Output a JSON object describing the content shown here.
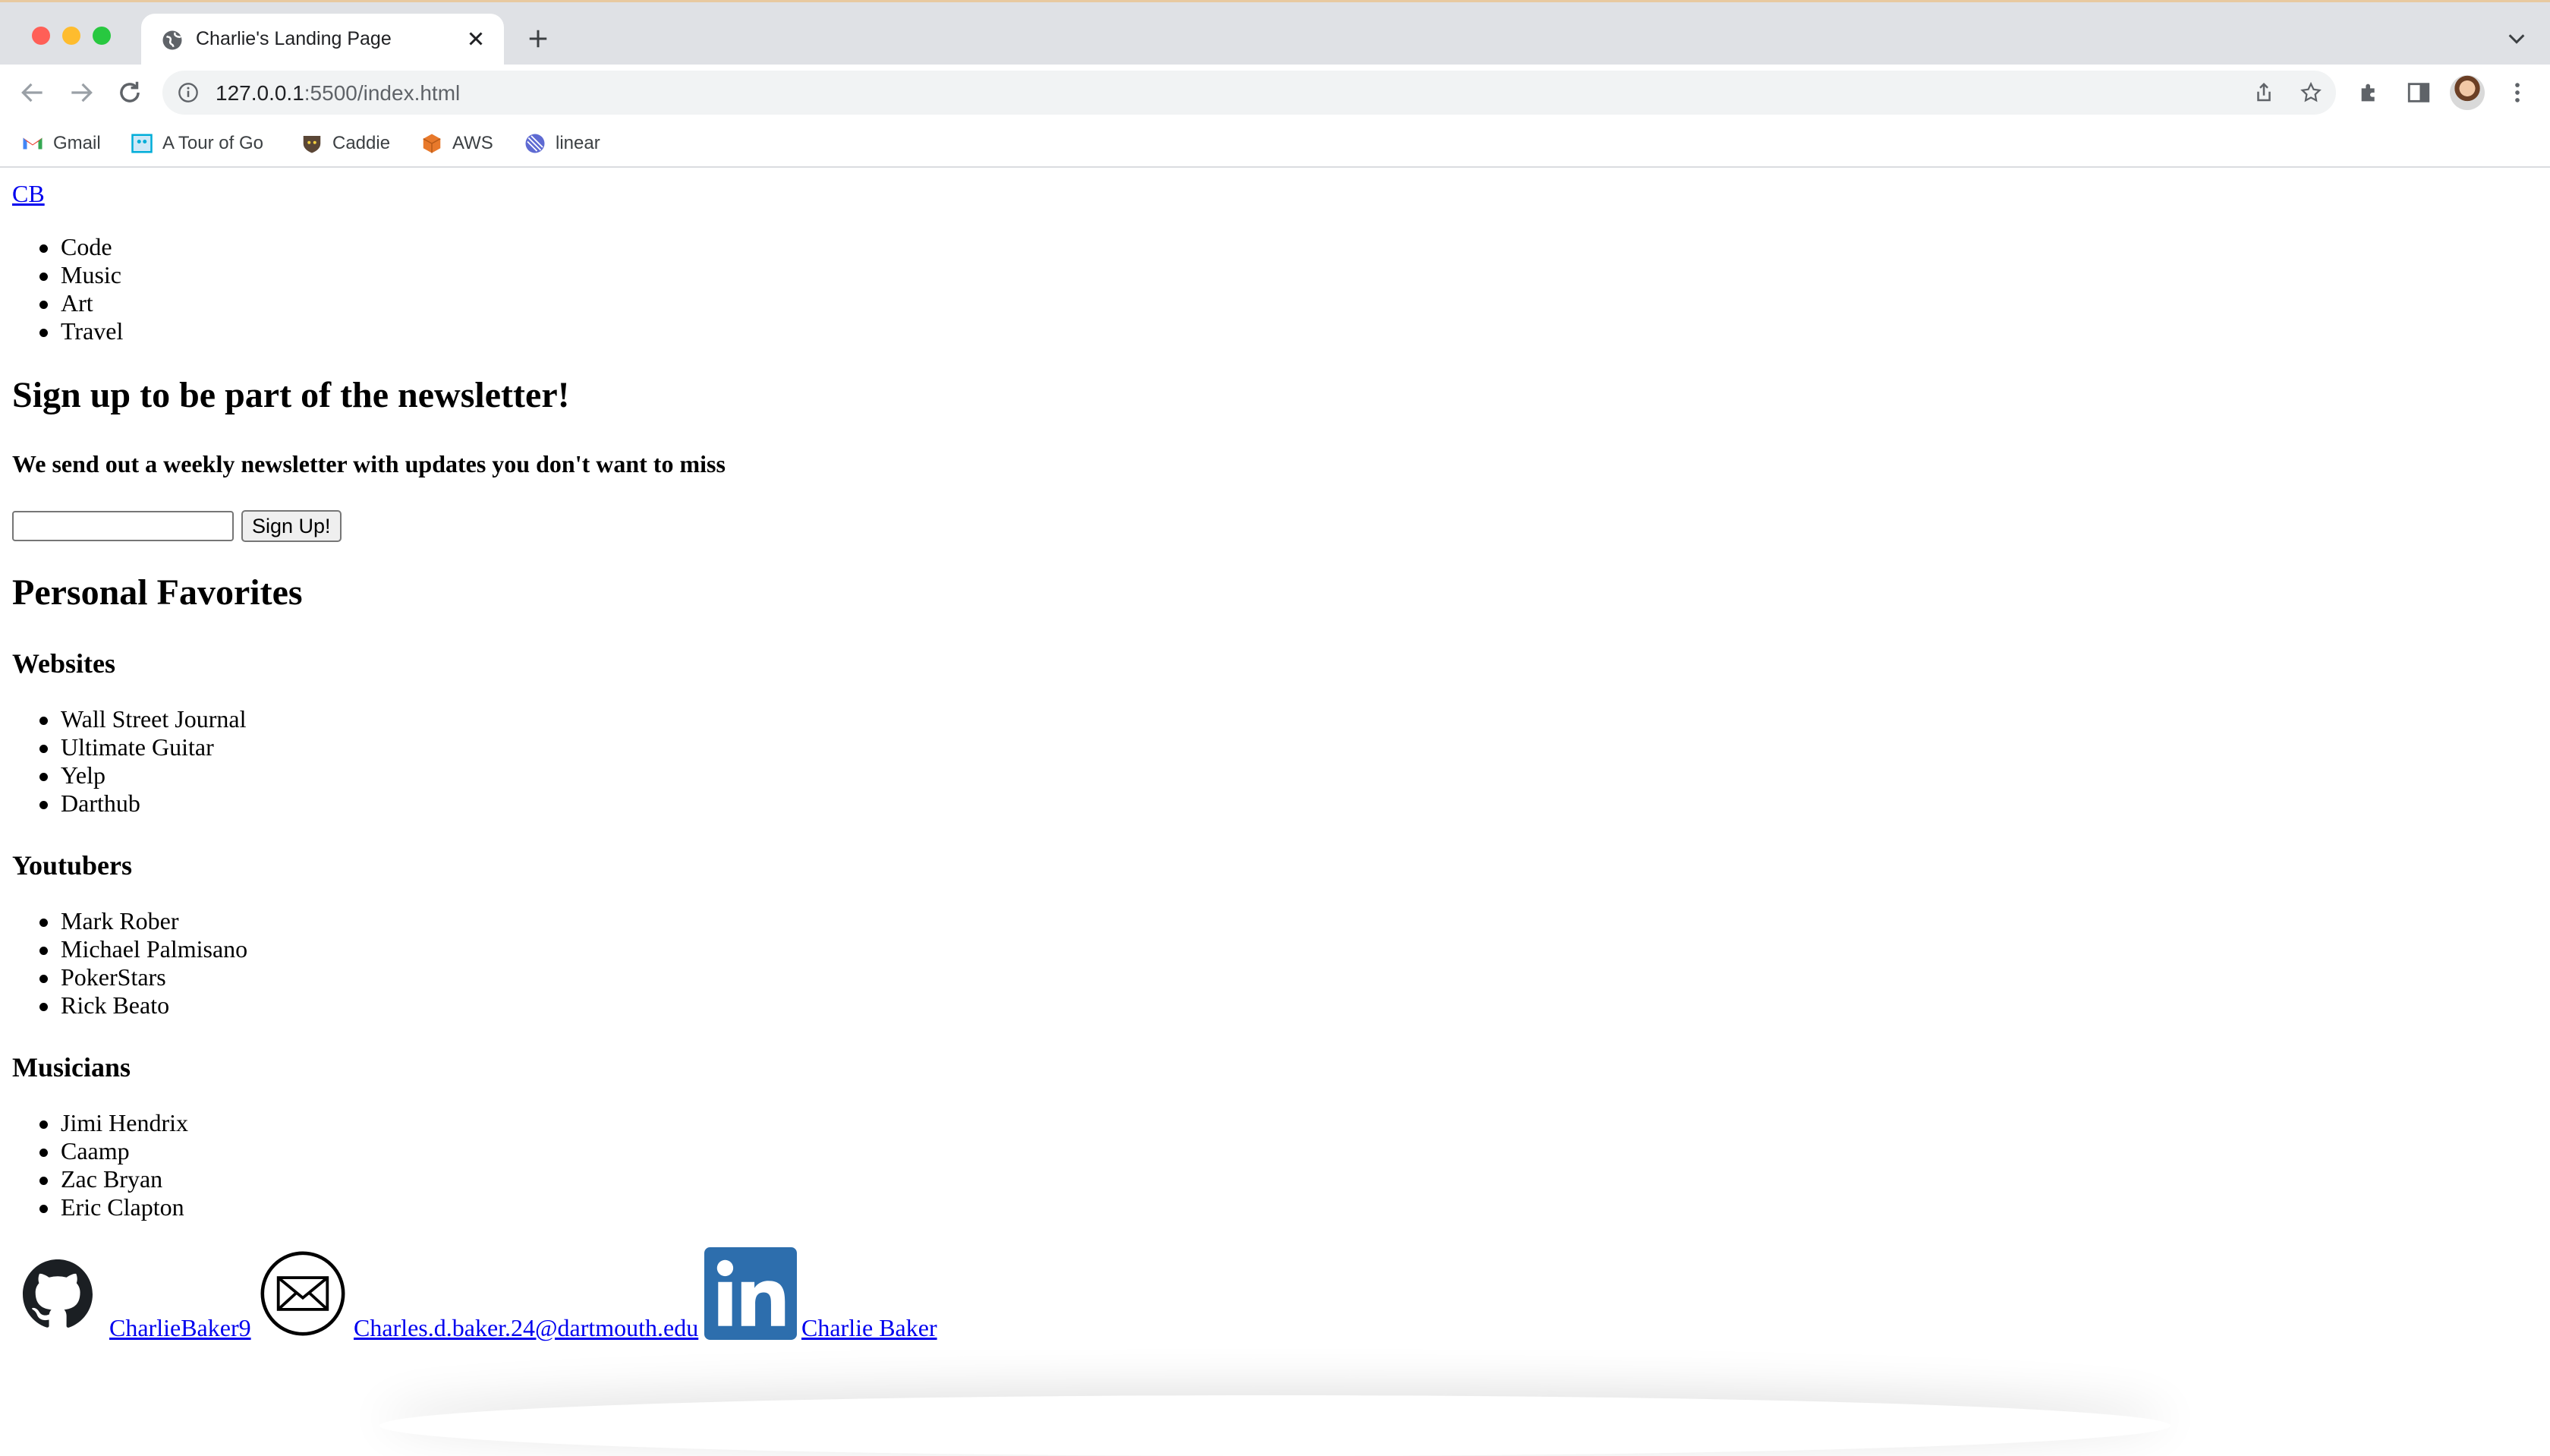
{
  "browser": {
    "tab_title": "Charlie's Landing Page",
    "url_host": "127.0.0.1",
    "url_rest": ":5500/index.html"
  },
  "bookmarks": [
    {
      "label": "Gmail",
      "icon": "gmail-icon"
    },
    {
      "label": "A Tour of Go",
      "icon": "go-icon"
    },
    {
      "label": "Caddie",
      "icon": "caddie-icon"
    },
    {
      "label": "AWS",
      "icon": "aws-icon"
    },
    {
      "label": "linear",
      "icon": "linear-icon"
    }
  ],
  "page": {
    "logo_link": "CB",
    "nav_items": [
      "Code",
      "Music",
      "Art",
      "Travel"
    ],
    "newsletter": {
      "heading": "Sign up to be part of the newsletter!",
      "subheading": "We send out a weekly newsletter with updates you don't want to miss",
      "input_value": "",
      "button_label": "Sign Up!"
    },
    "favorites": {
      "heading": "Personal Favorites",
      "websites": {
        "heading": "Websites",
        "items": [
          "Wall Street Journal",
          "Ultimate Guitar",
          "Yelp",
          "Darthub"
        ]
      },
      "youtubers": {
        "heading": "Youtubers",
        "items": [
          "Mark Rober",
          "Michael Palmisano",
          "PokerStars",
          "Rick Beato"
        ]
      },
      "musicians": {
        "heading": "Musicians",
        "items": [
          "Jimi Hendrix",
          "Caamp",
          "Zac Bryan",
          "Eric Clapton"
        ]
      }
    },
    "social": {
      "github_label": "CharlieBaker9",
      "email_label": "Charles.d.baker.24@dartmouth.edu",
      "linkedin_label": "Charlie Baker"
    }
  },
  "colors": {
    "link": "#0000ee",
    "linkedin_blue": "#2d6ead",
    "tabstrip": "#dfe1e5"
  }
}
